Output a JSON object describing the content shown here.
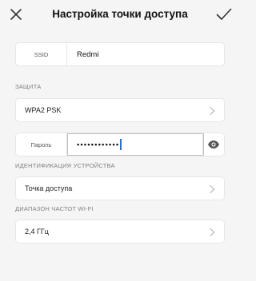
{
  "header": {
    "title": "Настройка точки доступа",
    "close_icon": "close-icon",
    "confirm_icon": "checkmark-icon"
  },
  "ssid": {
    "label": "SSID",
    "value": "Redmi"
  },
  "security": {
    "section_label": "ЗАЩИТА",
    "value": "WPA2 PSK"
  },
  "password": {
    "label": "Пароль",
    "masked_value": "••••••••••••",
    "visibility_icon": "eye-icon"
  },
  "device_id": {
    "section_label": "ИДЕНТИФИКАЦИЯ УСТРОЙСТВА",
    "value": "Точка доступа"
  },
  "band": {
    "section_label": "ДИАПАЗОН ЧАСТОТ WI-FI",
    "value": "2,4 ГГц"
  },
  "colors": {
    "background": "#f5f5f5",
    "card": "#ffffff",
    "caret": "#1a73e8"
  }
}
